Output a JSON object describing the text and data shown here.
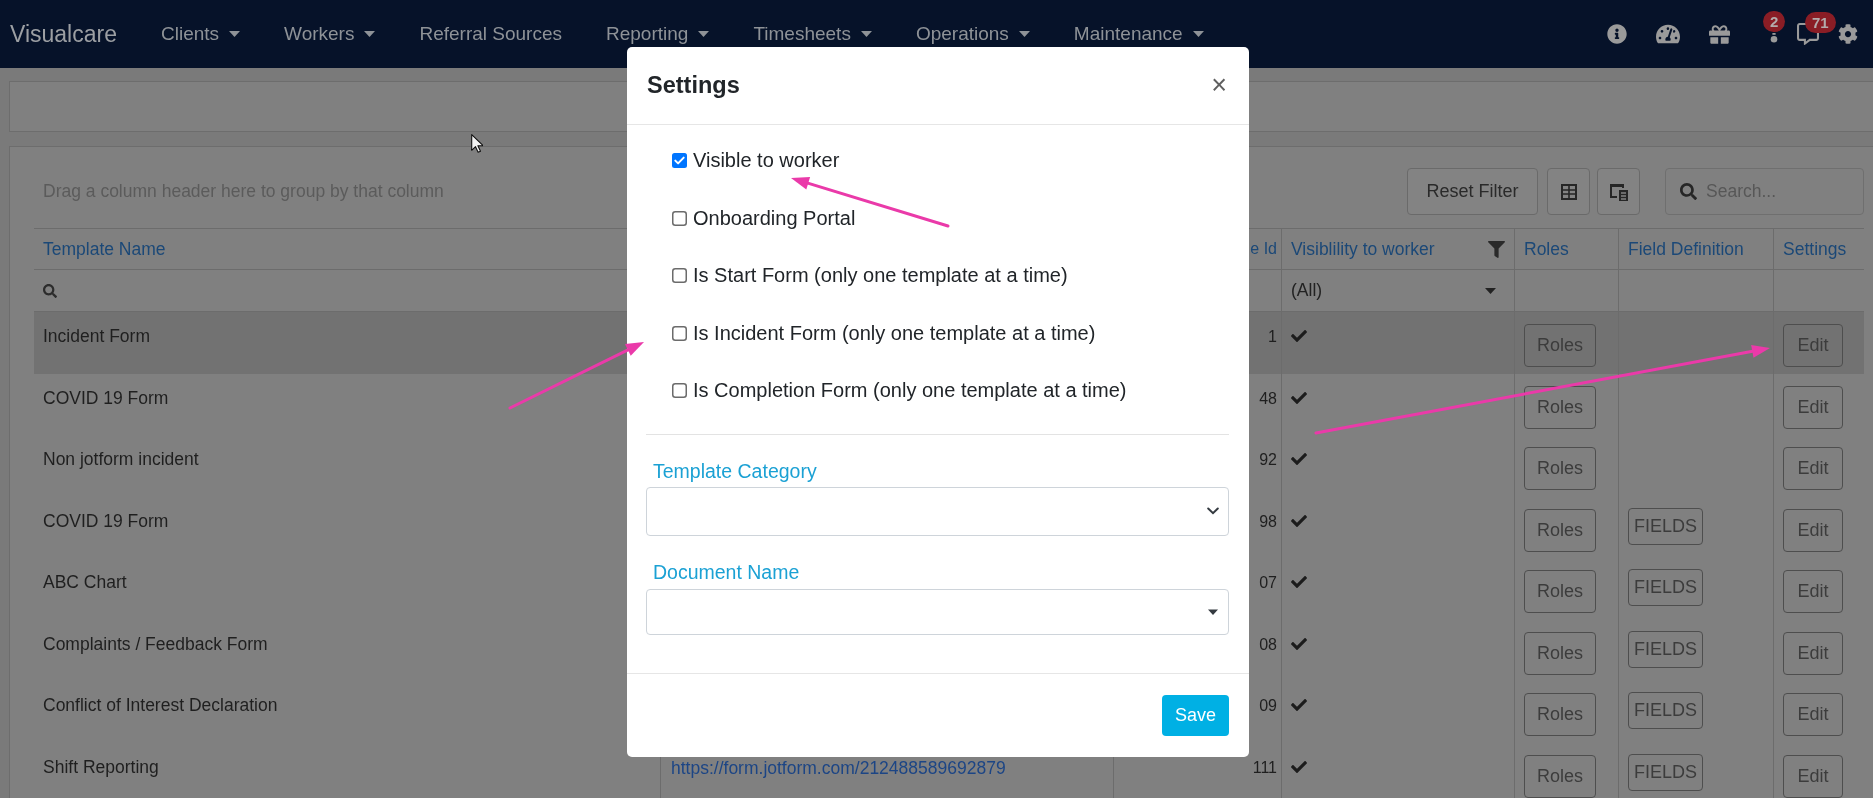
{
  "navbar": {
    "brand": "Visualcare",
    "menu": [
      {
        "label": "Clients",
        "dropdown": true
      },
      {
        "label": "Workers",
        "dropdown": true
      },
      {
        "label": "Referral Sources",
        "dropdown": false
      },
      {
        "label": "Reporting",
        "dropdown": true
      },
      {
        "label": "Timesheets",
        "dropdown": true
      },
      {
        "label": "Operations",
        "dropdown": true
      },
      {
        "label": "Maintenance",
        "dropdown": true
      }
    ],
    "alerts_count": "2",
    "messages_count": "71"
  },
  "grid": {
    "group_panel_hint": "Drag a column header here to group by that column",
    "reset_filter": "Reset Filter",
    "search": {
      "placeholder": "Search..."
    },
    "columns": [
      "Template Name",
      "e Id",
      "Visiblility to worker",
      "Roles",
      "Field Definition",
      "Settings"
    ],
    "visibility_filter": "(All)",
    "rows": [
      {
        "name": "Incident Form",
        "template_id": "1",
        "visible": true,
        "roles": "Roles",
        "edit": "Edit",
        "selected": true
      },
      {
        "name": "COVID 19 Form",
        "template_id": "48",
        "visible": true,
        "roles": "Roles",
        "edit": "Edit",
        "selected": false
      },
      {
        "name": "Non jotform incident",
        "template_id": "92",
        "visible": true,
        "roles": "Roles",
        "edit": "Edit",
        "selected": false
      },
      {
        "name": "COVID 19 Form",
        "template_id": "98",
        "visible": true,
        "roles": "Roles",
        "field_definition": "FIELDS",
        "edit": "Edit",
        "selected": false
      },
      {
        "name": "ABC Chart",
        "template_id": "07",
        "visible": true,
        "roles": "Roles",
        "field_definition": "FIELDS",
        "edit": "Edit",
        "selected": false
      },
      {
        "name": "Complaints / Feedback Form",
        "template_id": "08",
        "visible": true,
        "roles": "Roles",
        "field_definition": "FIELDS",
        "edit": "Edit",
        "selected": false
      },
      {
        "name": "Conflict of Interest Declaration",
        "template_id": "09",
        "visible": true,
        "roles": "Roles",
        "field_definition": "FIELDS",
        "edit": "Edit",
        "selected": false
      },
      {
        "name": "Shift Reporting",
        "form_url": "https://form.jotform.com/212488589692879",
        "template_id": "111",
        "visible": true,
        "roles": "Roles",
        "field_definition": "FIELDS",
        "edit": "Edit",
        "selected": false
      }
    ]
  },
  "modal": {
    "title": "Settings",
    "close": "×",
    "options": [
      {
        "label": "Visible to worker",
        "checked": true
      },
      {
        "label": "Onboarding Portal",
        "checked": false
      },
      {
        "label": "Is Start Form (only one template at a time)",
        "checked": false
      },
      {
        "label": "Is Incident Form (only one template at a time)",
        "checked": false
      },
      {
        "label": "Is Completion Form (only one template at a time)",
        "checked": false
      }
    ],
    "template_category": {
      "label": "Template Category"
    },
    "document_name": {
      "label": "Document Name"
    },
    "save": "Save"
  }
}
